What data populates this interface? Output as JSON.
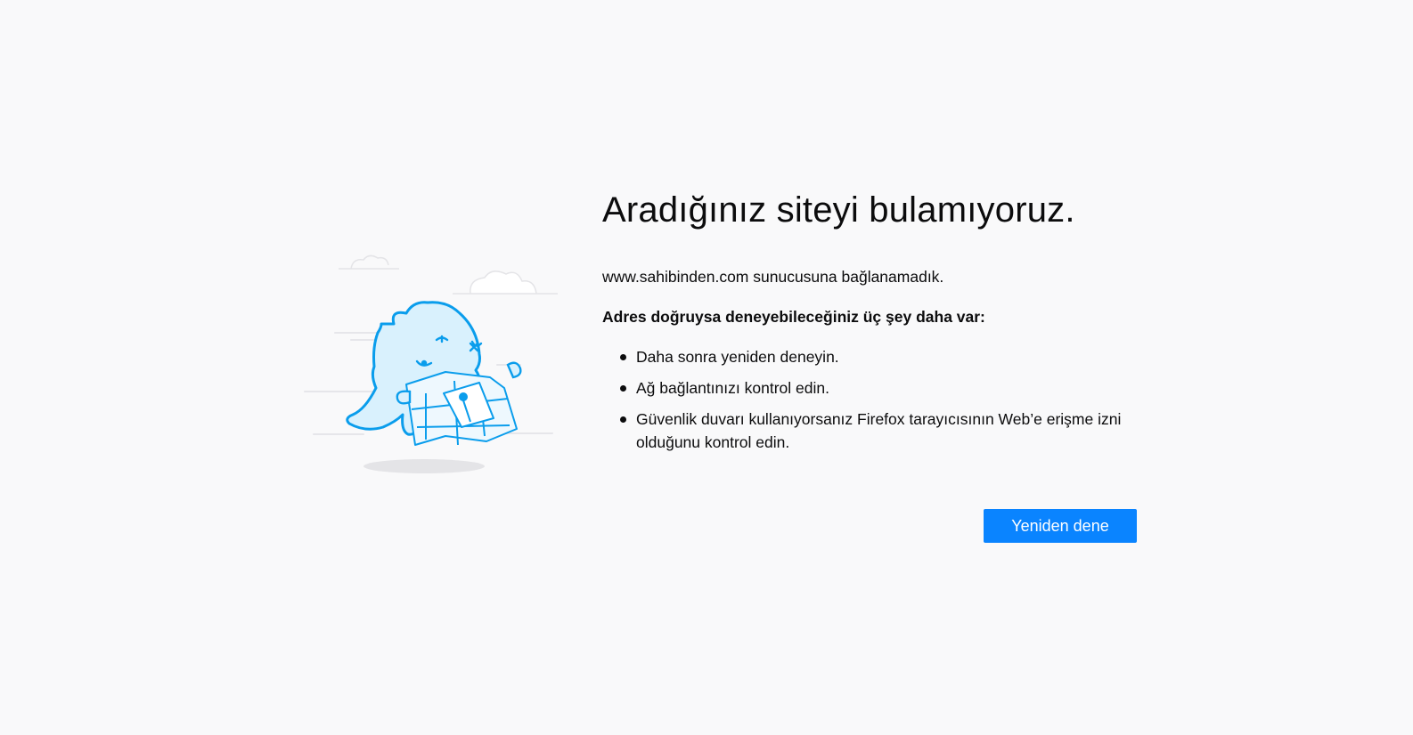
{
  "error": {
    "title": "Aradığınız siteyi bulamıyoruz.",
    "description": "www.sahibinden.com sunucusuna bağlanamadık.",
    "suggestions_heading": "Adres doğruysa deneyebileceğiniz üç şey daha var:",
    "suggestions": [
      "Daha sonra yeniden deneyin.",
      "Ağ bağlantınızı kontrol edin.",
      "Güvenlik duvarı kullanıyorsanız Firefox tarayıcısının Web’e erişme izni olduğunu kontrol edin."
    ],
    "retry_label": "Yeniden dene"
  },
  "illustration": {
    "icon": "lost-monster-with-map-icon",
    "stroke_color": "#0a9dec",
    "fill_color": "#d9f1fd"
  },
  "colors": {
    "background": "#f9f9fa",
    "button": "#0a84ff",
    "button_text": "#ffffff"
  }
}
